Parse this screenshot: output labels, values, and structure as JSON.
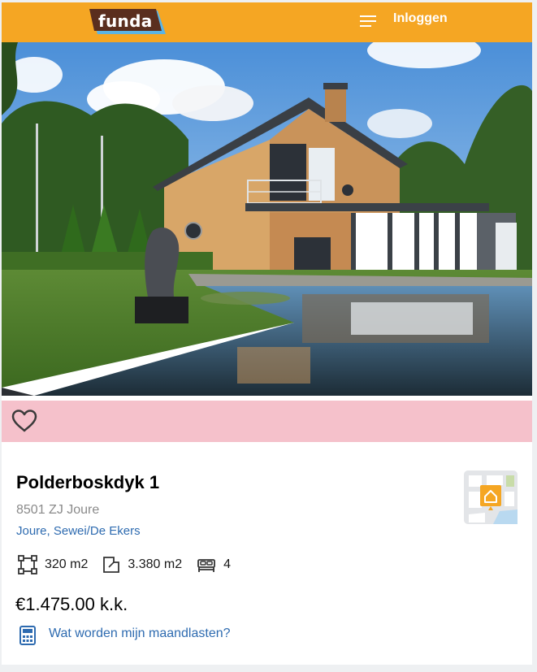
{
  "header": {
    "logo_text": "funda",
    "menu_icon": "hamburger-menu-icon",
    "login_label": "Inloggen"
  },
  "photo": {
    "description_icon": "house-photo"
  },
  "favorite": {
    "icon": "heart-outline-icon"
  },
  "listing": {
    "title": "Polderboskdyk 1",
    "postal": "8501 ZJ Joure",
    "area_link": "Joure, Sewei/De Ekers",
    "features": [
      {
        "icon": "living-area-icon",
        "value": "320 m2"
      },
      {
        "icon": "plot-area-icon",
        "value": "3.380 m2"
      },
      {
        "icon": "bed-icon",
        "value": "4"
      }
    ],
    "price": "€1.475.00 k.k.",
    "mortgage_link": "Wat worden mijn maandlasten?"
  },
  "colors": {
    "header_bg": "#f5a623",
    "fav_bar_bg": "#f5c1cb",
    "link": "#2e6bb0",
    "logo_dark": "#5a2e1e",
    "logo_blue": "#5bb4e5"
  }
}
